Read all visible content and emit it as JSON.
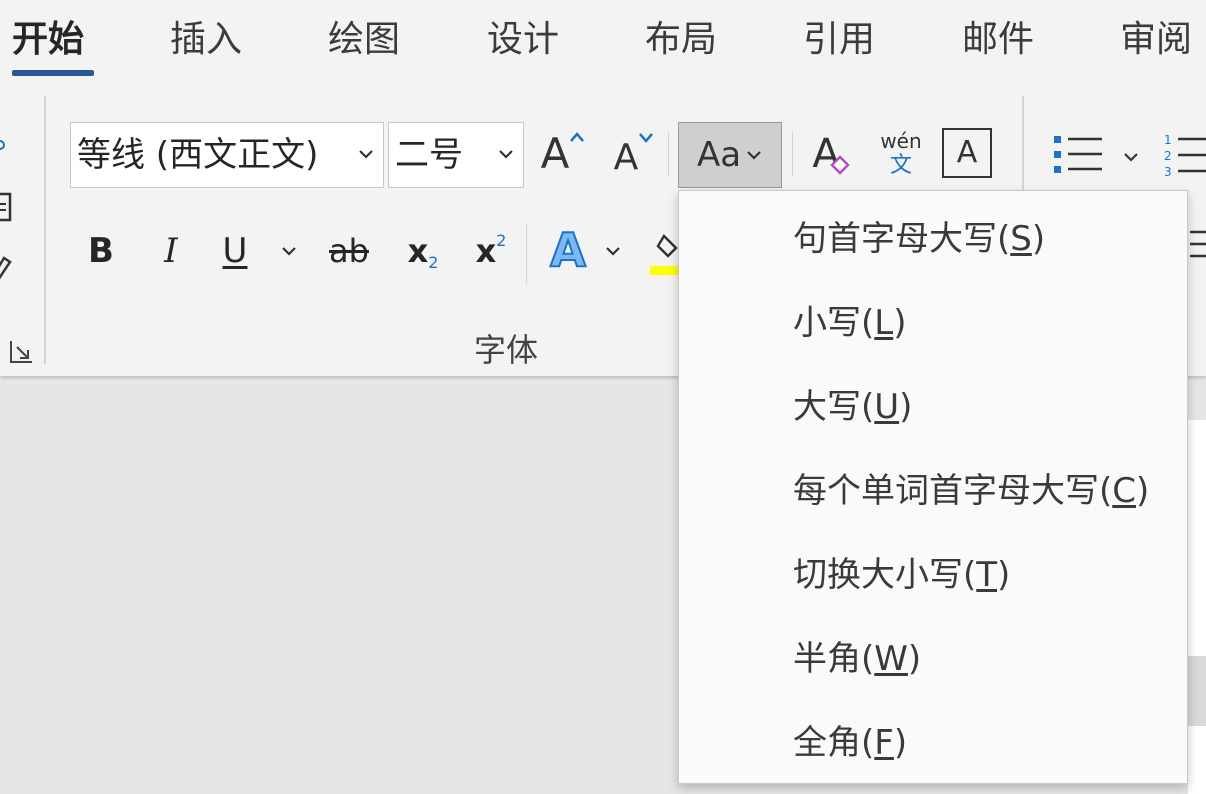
{
  "tabs": [
    {
      "label": "开始",
      "active": true
    },
    {
      "label": "插入"
    },
    {
      "label": "绘图"
    },
    {
      "label": "设计"
    },
    {
      "label": "布局"
    },
    {
      "label": "引用"
    },
    {
      "label": "邮件"
    },
    {
      "label": "审阅"
    }
  ],
  "font": {
    "name_value": "等线 (西文正文)",
    "size_value": "二号",
    "change_case_label": "Aa",
    "phonetic_top": "wén",
    "phonetic_bottom": "文",
    "border_char_label": "A",
    "grow_label": "A",
    "shrink_label": "A",
    "bold_label": "B",
    "italic_label": "I",
    "underline_label": "U",
    "strike_label": "ab",
    "sub_label": "x",
    "sub_index": "2",
    "sup_label": "x",
    "sup_index": "2",
    "effects_label": "A",
    "clear_format_label": "A",
    "group_label": "字体"
  },
  "menu": {
    "items": [
      {
        "text": "句首字母大写(",
        "key": "S",
        "end": ")"
      },
      {
        "text": "小写(",
        "key": "L",
        "end": ")"
      },
      {
        "text": "大写(",
        "key": "U",
        "end": ")"
      },
      {
        "text": "每个单词首字母大写(",
        "key": "C",
        "end": ")"
      },
      {
        "text": "切换大小写(",
        "key": "T",
        "end": ")"
      },
      {
        "text": "半角(",
        "key": "W",
        "end": ")"
      },
      {
        "text": "全角(",
        "key": "F",
        "end": ")"
      }
    ]
  },
  "colors": {
    "accent": "#2b5797",
    "highlight": "#ffff00",
    "effects_blue": "#1a73c9",
    "eraser_purple": "#b04fc4"
  }
}
